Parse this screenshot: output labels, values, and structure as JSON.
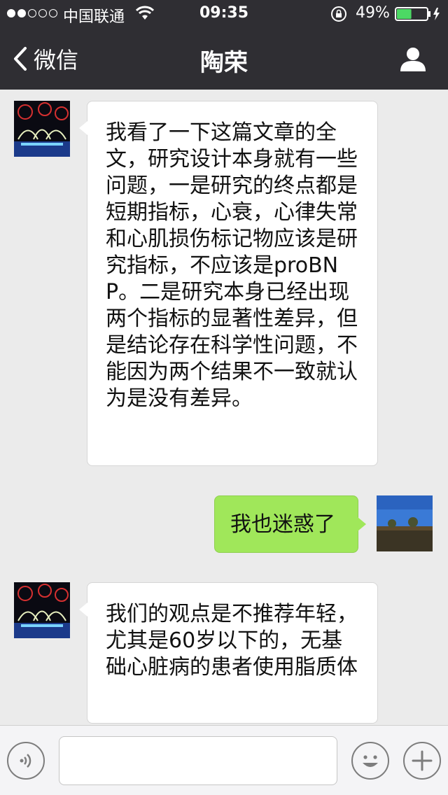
{
  "status_bar": {
    "carrier": "中国联通",
    "time": "09:35",
    "battery": "49%",
    "signal_bars": 2,
    "battery_level": 0.49
  },
  "nav": {
    "back_label": "微信",
    "title": "陶荣"
  },
  "messages": [
    {
      "sender": "other",
      "text": "我看了一下这篇文章的全文，研究设计本身就有一些问题，一是研究的终点都是短期指标，心衰，心律失常和心肌损伤标记物应该是研究指标，不应该是proBNP。二是研究本身已经出现两个指标的显著性差异，但是结论存在科学性问题，不能因为两个结果不一致就认为是没有差异。"
    },
    {
      "sender": "self",
      "text": "我也迷惑了"
    },
    {
      "sender": "other",
      "text": "我们的观点是不推荐年轻，尤其是60岁以下的，无基础心脏病的患者使用脂质体"
    }
  ],
  "input": {
    "placeholder": ""
  },
  "colors": {
    "nav_background": "#2f2e33",
    "chat_background": "#ebebeb",
    "self_bubble": "#a0e75a",
    "other_bubble": "#ffffff",
    "battery_fill": "#4cd964"
  },
  "icons": {
    "back": "chevron-left-icon",
    "profile": "person-icon",
    "voice": "voice-icon",
    "emoji": "smiley-icon",
    "plus": "plus-icon",
    "wifi": "wifi-icon",
    "lock": "rotation-lock-icon",
    "battery": "battery-icon"
  }
}
